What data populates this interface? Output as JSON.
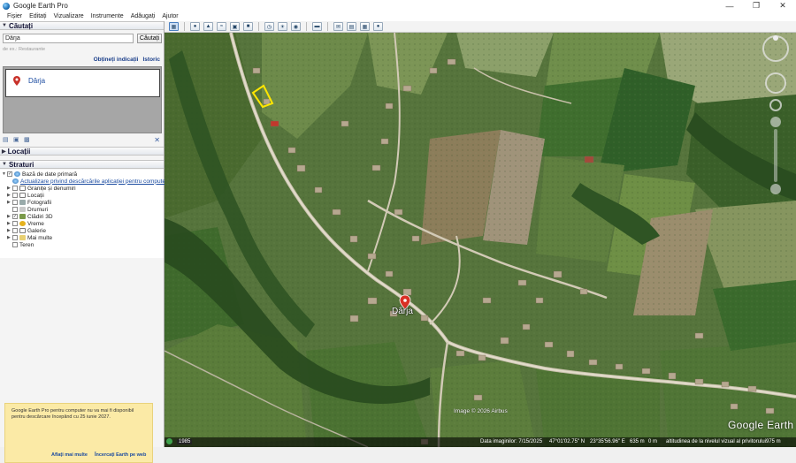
{
  "window": {
    "title": "Google Earth Pro",
    "minimize_icon": "minimize-icon",
    "maximize_icon": "maximize-icon",
    "close_icon": "close-icon"
  },
  "menu": [
    "Fișier",
    "Editați",
    "Vizualizare",
    "Instrumente",
    "Adăugați",
    "Ajutor"
  ],
  "toolbar": {
    "icons": [
      "sidebar-toggle-icon",
      "add-placemark-icon",
      "add-polygon-icon",
      "add-path-icon",
      "add-overlay-icon",
      "record-tour-icon",
      "historical-imagery-icon",
      "sunlight-icon",
      "planets-icon",
      "ruler-icon",
      "email-icon",
      "print-icon",
      "save-image-icon",
      "view-in-maps-icon"
    ]
  },
  "search": {
    "header": "Căutați",
    "value": "Dârja",
    "button": "Căutați",
    "hint": "de ex.: Restaurante",
    "get_directions": "Obțineți indicații",
    "history": "Istoric",
    "result": "Dârja",
    "close": "✕"
  },
  "places": {
    "header": "Locații"
  },
  "layers": {
    "header": "Straturi",
    "items": [
      "Bază de date primară",
      "Actualizare privind descărcările aplicației pentru computer",
      "Granițe și denumiri",
      "Locații",
      "Fotografii",
      "Drumuri",
      "Clădiri 3D",
      "Vreme",
      "Galerie",
      "Mai multe",
      "Teren"
    ]
  },
  "promo": {
    "text": "Google Earth Pro pentru computer nu va mai fi disponibil pentru descărcare începând cu 25 iunie 2027.",
    "learn_more": "Aflați mai multe",
    "try_web": "Încercați Earth pe web"
  },
  "map": {
    "place_label": "Dârja",
    "attribution": "Image © 2026 Airbus",
    "brand": "Google Earth"
  },
  "status": {
    "tour_year": "1985",
    "imagery_date": "Data imaginilor: 7/15/2025",
    "lat": "47°01'02.75\" N",
    "lon": "23°35'56.96\" E",
    "elev": "635 m",
    "alt_label": "altitudinea de la nivelul vizual al privitorului",
    "alt": "975 m",
    "zero": "0 m"
  }
}
